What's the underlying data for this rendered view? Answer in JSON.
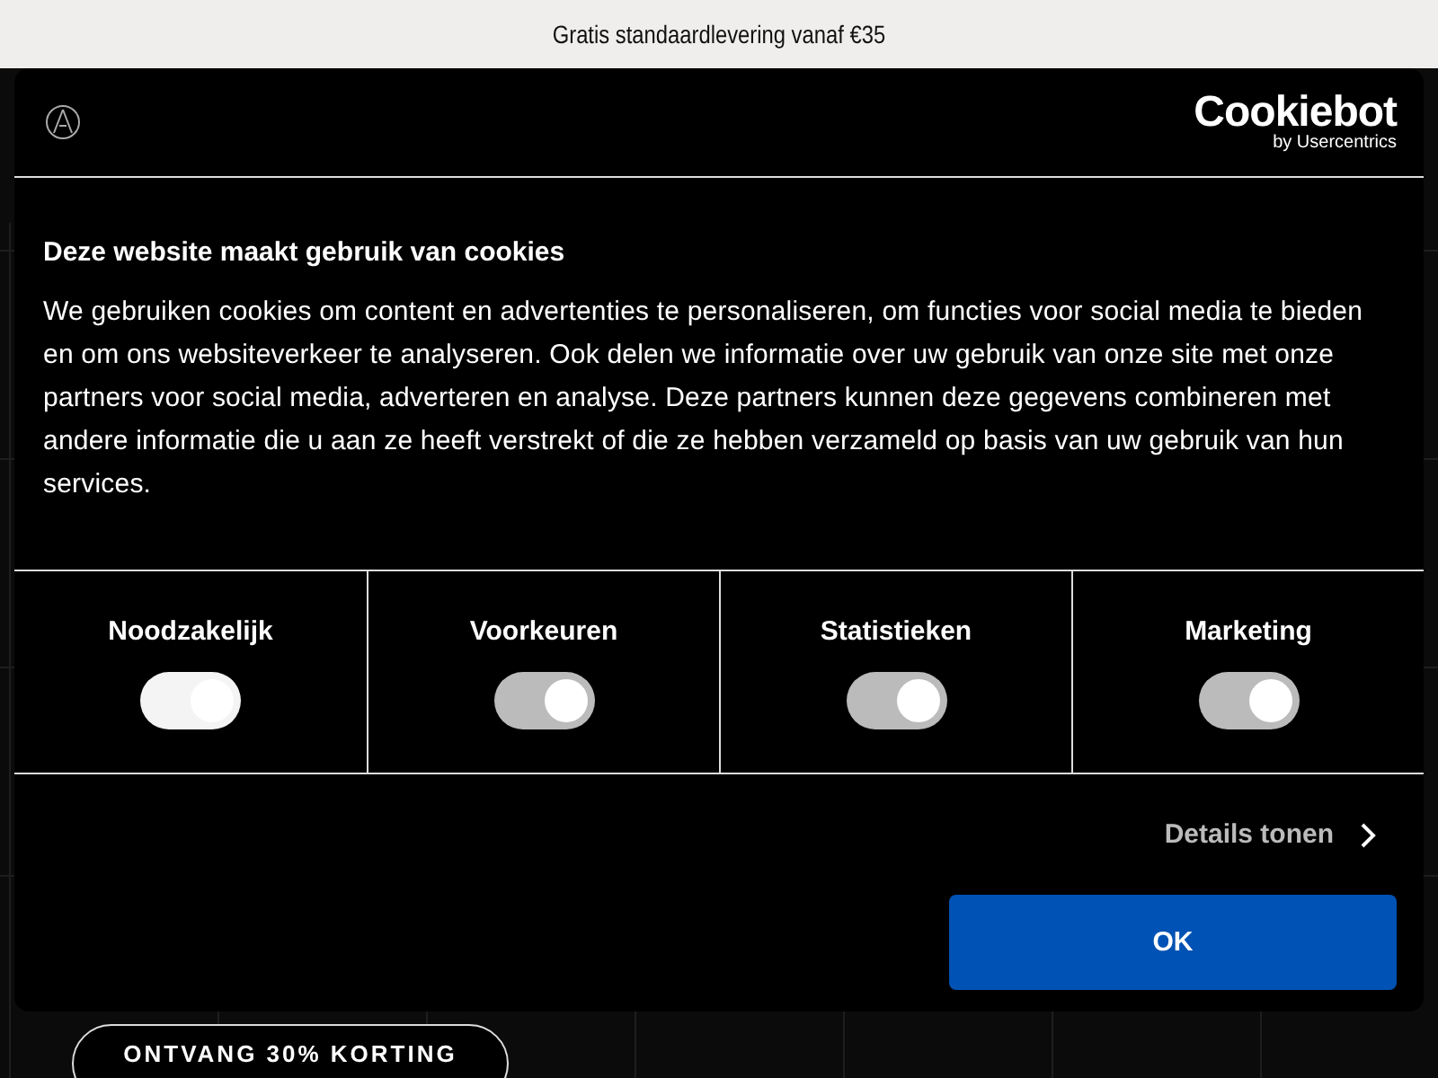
{
  "promo_bar": {
    "text": "Gratis standaardlevering vanaf €35"
  },
  "dialog": {
    "brand": {
      "name": "Cookiebot",
      "byline": "by Usercentrics"
    },
    "title": "Deze website maakt gebruik van cookies",
    "body": "We gebruiken cookies om content en advertenties te personaliseren, om functies voor social media te bieden en om ons websiteverkeer te analyseren. Ook delen we informatie over uw gebruik van onze site met onze partners voor social media, adverteren en analyse. Deze partners kunnen deze gegevens combineren met andere informatie die u aan ze heeft verstrekt of die ze hebben verzameld op basis van uw gebruik van hun services.",
    "categories": [
      {
        "label": "Noodzakelijk",
        "checked": true,
        "disabled": true
      },
      {
        "label": "Voorkeuren",
        "checked": true,
        "disabled": false
      },
      {
        "label": "Statistieken",
        "checked": true,
        "disabled": false
      },
      {
        "label": "Marketing",
        "checked": true,
        "disabled": false
      }
    ],
    "details_link": "Details tonen",
    "ok_button": "OK"
  },
  "page": {
    "cta_button": "ONTVANG 30% KORTING"
  }
}
